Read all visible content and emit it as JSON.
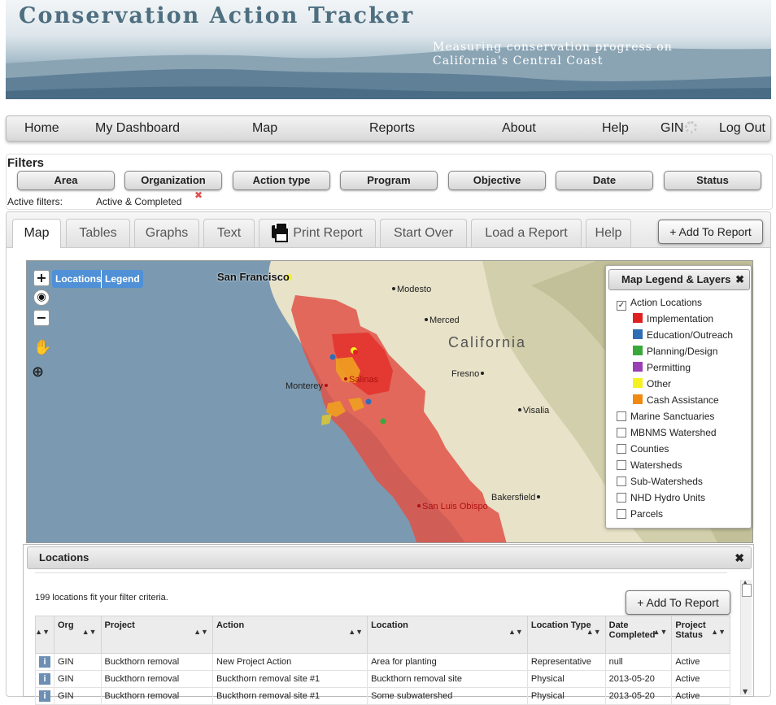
{
  "banner": {
    "title": "Conservation Action Tracker",
    "subtitle_line1": "Measuring conservation progress on",
    "subtitle_line2": "California's Central Coast"
  },
  "nav": {
    "home": "Home",
    "dashboard": "My Dashboard",
    "map": "Map",
    "reports": "Reports",
    "about": "About",
    "help": "Help",
    "org": "GIN",
    "logout": "Log Out"
  },
  "filters": {
    "label": "Filters",
    "buttons": [
      "Area",
      "Organization",
      "Action type",
      "Program",
      "Objective",
      "Date",
      "Status"
    ],
    "active_label": "Active filters:",
    "active_value": "Active & Completed",
    "remove_glyph": "✖"
  },
  "tabs": {
    "items": [
      "Map",
      "Tables",
      "Graphs",
      "Text",
      "Print Report",
      "Start Over",
      "Load a Report",
      "Help"
    ],
    "active": "Map",
    "add_to_report": "+ Add To Report"
  },
  "map": {
    "zoom_in": "+",
    "zoom_out": "−",
    "tab_locations": "Locations",
    "tab_legend": "Legend",
    "places": {
      "sf": "San Francisco",
      "modesto": "Modesto",
      "merced": "Merced",
      "california": "California",
      "fresno": "Fresno",
      "monterey": "Monterey",
      "salinas": "Salinas",
      "visalia": "Visalia",
      "bakersfield": "Bakersfield",
      "slo": "San Luis Obispo"
    }
  },
  "legend": {
    "title": "Map Legend & Layers",
    "close": "✖",
    "action_locations": "Action Locations",
    "categories": [
      {
        "label": "Implementation",
        "color": "#e02020"
      },
      {
        "label": "Education/Outreach",
        "color": "#2f6db5"
      },
      {
        "label": "Planning/Design",
        "color": "#3aa83a"
      },
      {
        "label": "Permitting",
        "color": "#9b3fb5"
      },
      {
        "label": "Other",
        "color": "#f5f020"
      },
      {
        "label": "Cash Assistance",
        "color": "#f08a10"
      }
    ],
    "layers": [
      "Marine Sanctuaries",
      "MBNMS Watershed",
      "Counties",
      "Watersheds",
      "Sub-Watersheds",
      "NHD Hydro Units",
      "Parcels"
    ]
  },
  "locations": {
    "title": "Locations",
    "close": "✖",
    "count_text": "199 locations fit your filter criteria.",
    "add_to_report": "+ Add To Report",
    "columns": [
      "",
      "Org",
      "Project",
      "Action",
      "Location",
      "Location Type",
      "Date Completed",
      "Project Status"
    ],
    "rows": [
      {
        "org": "GIN",
        "project": "Buckthorn removal",
        "action": "New Project Action",
        "location": "Area for planting",
        "type": "Representative",
        "date": "null",
        "status": "Active"
      },
      {
        "org": "GIN",
        "project": "Buckthorn removal",
        "action": "Buckthorn removal site #1",
        "location": "Buckthorn removal site",
        "type": "Physical",
        "date": "2013-05-20",
        "status": "Active"
      },
      {
        "org": "GIN",
        "project": "Buckthorn removal",
        "action": "Buckthorn removal site #1",
        "location": "Some subwatershed",
        "type": "Physical",
        "date": "2013-05-20",
        "status": "Active"
      }
    ]
  }
}
